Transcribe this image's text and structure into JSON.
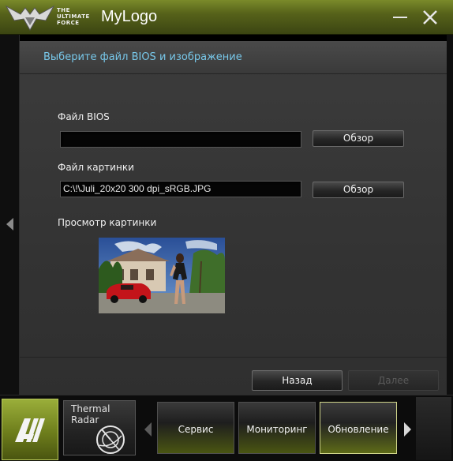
{
  "window": {
    "logo_lines": [
      "THE",
      "ULTIMATE",
      "FORCE"
    ],
    "title": "MyLogo",
    "minimize_icon": "minimize-icon",
    "close_icon": "close-icon"
  },
  "panel": {
    "title": "Выберите файл BIOS и изображение",
    "bios_label": "Файл BIOS",
    "bios_value": "",
    "bios_browse": "Обзор",
    "image_label": "Файл картинки",
    "image_value": "C:\\!\\Juli_20x20 300 dpi_sRGB.JPG",
    "image_browse": "Обзор",
    "preview_label": "Просмотр картинки",
    "back_button": "Назад",
    "next_button": "Далее",
    "next_enabled": false
  },
  "bottom_nav": {
    "home_icon": "ai-suite-logo-icon",
    "thermal_radar": "Thermal Radar",
    "tabs": [
      {
        "label": "Сервис",
        "active": false
      },
      {
        "label": "Мониторинг",
        "active": false
      },
      {
        "label": "Обновление",
        "active": true
      }
    ]
  },
  "colors": {
    "accent": "#6e7e1c",
    "title_text": "#78c8ea",
    "panel_bg": "#383838"
  }
}
